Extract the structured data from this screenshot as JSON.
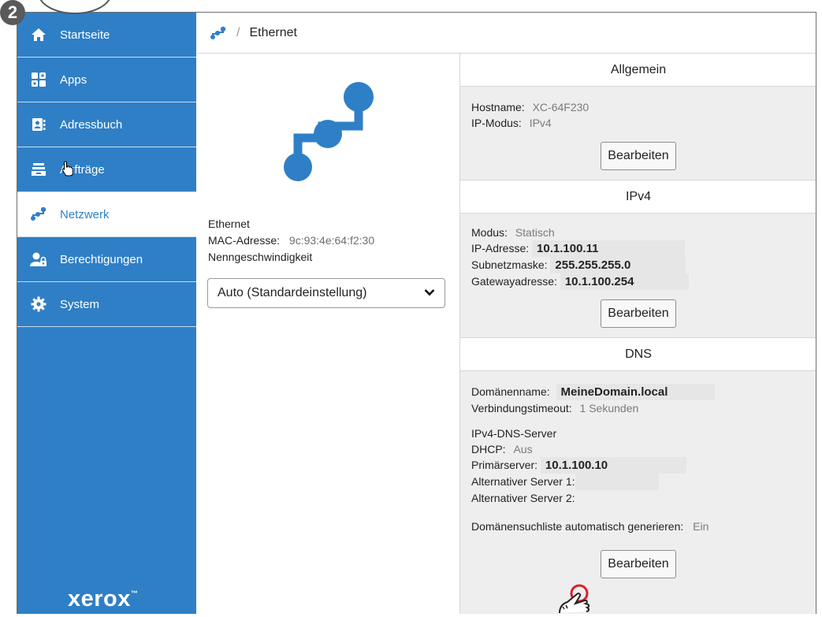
{
  "step_badge": "2",
  "breadcrumb": {
    "separator": "/",
    "current": "Ethernet"
  },
  "sidebar": {
    "items": [
      {
        "label": "Startseite",
        "icon": "home-icon"
      },
      {
        "label": "Apps",
        "icon": "apps-grid-icon"
      },
      {
        "label": "Adressbuch",
        "icon": "address-book-icon"
      },
      {
        "label": "Aufträge",
        "icon": "jobs-tray-icon"
      },
      {
        "label": "Netzwerk",
        "icon": "network-icon",
        "active": true
      },
      {
        "label": "Berechtigungen",
        "icon": "permissions-icon"
      },
      {
        "label": "System",
        "icon": "gear-icon"
      }
    ],
    "brand": "xerox"
  },
  "ethernet": {
    "title": "Ethernet",
    "mac_label": "MAC-Adresse:",
    "mac_value": "9c:93:4e:64:f2:30",
    "speed_label": "Nenngeschwindigkeit",
    "speed_selected": "Auto (Standardeinstellung)"
  },
  "general": {
    "heading": "Allgemein",
    "hostname_label": "Hostname:",
    "hostname_value": "XC-64F230",
    "ipmode_label": "IP-Modus:",
    "ipmode_value": "IPv4",
    "edit_label": "Bearbeiten"
  },
  "ipv4": {
    "heading": "IPv4",
    "mode_label": "Modus:",
    "mode_value": "Statisch",
    "ip_label": "IP-Adresse:",
    "ip_value": "10.1.100.11",
    "subnet_label": "Subnetzmaske:",
    "subnet_value": "255.255.255.0",
    "gateway_label": "Gatewayadresse:",
    "gateway_value": "10.1.100.254",
    "edit_label": "Bearbeiten"
  },
  "dns": {
    "heading": "DNS",
    "domain_label": "Domänenname:",
    "domain_value": "MeineDomain.local",
    "timeout_label": "Verbindungstimeout:",
    "timeout_value": "1 Sekunden",
    "server_heading": "IPv4-DNS-Server",
    "dhcp_label": "DHCP:",
    "dhcp_value": "Aus",
    "primary_label": "Primärserver:",
    "primary_value": "10.1.100.10",
    "alt1_label": "Alternativer Server 1:",
    "alt2_label": "Alternativer Server 2:",
    "searchlist_label": "Domänensuchliste automatisch generieren:",
    "searchlist_value": "Ein",
    "edit_label": "Bearbeiten"
  },
  "colors": {
    "sidebar": "#2f7fc6",
    "accent": "#2f7fc6",
    "panel": "#eeeeee",
    "tap": "#e11d2a"
  }
}
